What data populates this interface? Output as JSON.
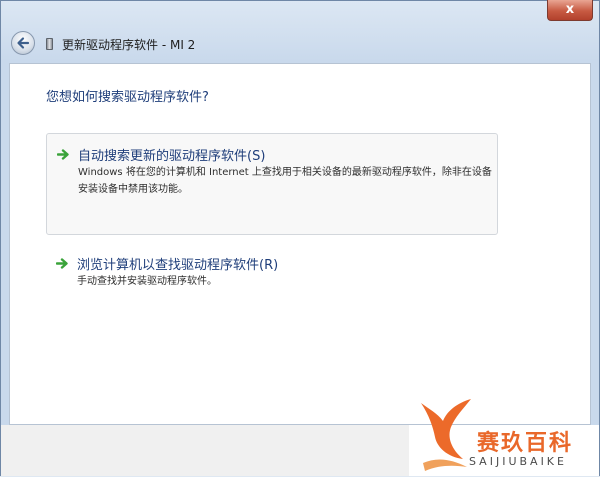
{
  "window": {
    "close_symbol": "x",
    "title": "更新驱动程序软件 - MI 2",
    "back_icon": "back-arrow-icon",
    "device_icon": "phone-device-icon"
  },
  "content": {
    "question": "您想如何搜索驱动程序软件?",
    "options": [
      {
        "title": "自动搜索更新的驱动程序软件(S)",
        "description": "Windows 将在您的计算机和 Internet 上查找用于相关设备的最新驱动程序软件，除非在设备安装设备中禁用该功能。",
        "icon": "green-arrow-icon"
      },
      {
        "title": "浏览计算机以查找驱动程序软件(R)",
        "description": "手动查找并安装驱动程序软件。",
        "icon": "green-arrow-icon"
      }
    ]
  },
  "watermark": {
    "cn": "赛玖百科",
    "en": "SAIJIUBAIKE"
  },
  "colors": {
    "link_blue": "#1f3e7a",
    "arrow_green": "#3aa33a",
    "watermark_orange": "#e9682a"
  }
}
